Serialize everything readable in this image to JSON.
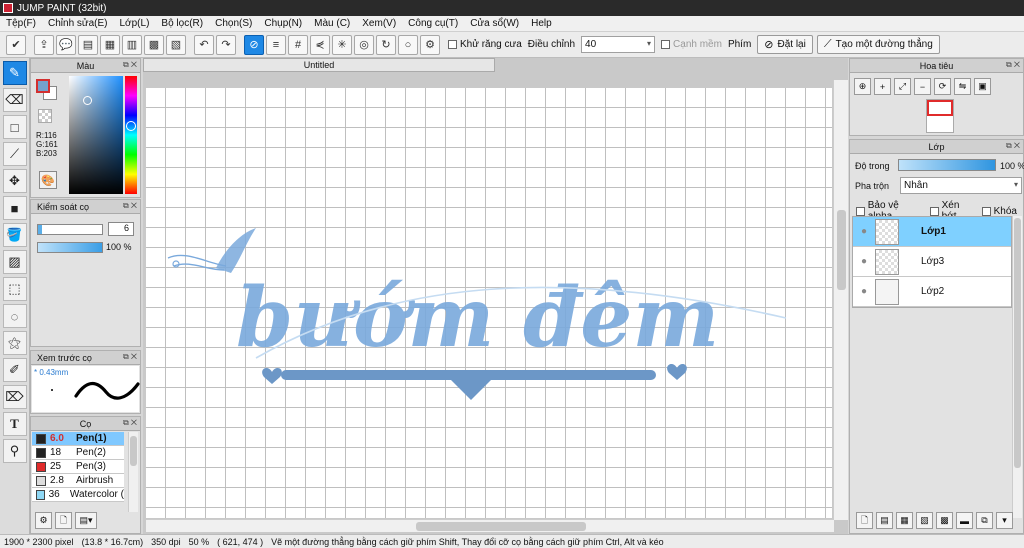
{
  "app": {
    "title": "JUMP PAINT (32bit)"
  },
  "menu": [
    "Tệp(F)",
    "Chỉnh sửa(E)",
    "Lớp(L)",
    "Bộ lọc(R)",
    "Chọn(S)",
    "Chụp(N)",
    "Màu (C)",
    "Xem(V)",
    "Công cụ(T)",
    "Cửa sổ(W)",
    "Help"
  ],
  "toolbar": {
    "antialias_label": "Khử răng cưa",
    "adjust_label": "Điều chỉnh",
    "adjust_value": "40",
    "edge_label": "Cạnh mềm",
    "key_label": "Phím",
    "reset_label": "Đặt lại",
    "straight_line_label": "Tạo một đường thẳng"
  },
  "color_panel": {
    "title": "Màu",
    "r": "R:116",
    "g": "G:161",
    "b": "B:203",
    "current_color": "#74a1cb"
  },
  "brush_control": {
    "title": "Kiểm soát cọ",
    "size": "6",
    "opacity": "100 %"
  },
  "brush_preview": {
    "title": "Xem trước cọ",
    "size_label": "* 0.43mm"
  },
  "brushes": {
    "title": "Cọ",
    "items": [
      {
        "size": "6.0",
        "name": "Pen(1)",
        "color": "#222222",
        "selected": true
      },
      {
        "size": "18",
        "name": "Pen(2)",
        "color": "#222222",
        "selected": false
      },
      {
        "size": "25",
        "name": "Pen(3)",
        "color": "#e02b2b",
        "selected": false
      },
      {
        "size": "2.8",
        "name": "Airbrush",
        "color": "#dddddd",
        "selected": false
      },
      {
        "size": "36",
        "name": "Watercolor (",
        "color": "#8fd8f5",
        "selected": false
      }
    ]
  },
  "document": {
    "tab": "Untitled"
  },
  "artwork": {
    "text": "bướm đêm",
    "color": "#7aa9dc"
  },
  "navigator": {
    "title": "Hoa tiêu"
  },
  "layers": {
    "title": "Lớp",
    "opacity_label": "Độ trong",
    "opacity_value": "100 %",
    "blend_label": "Pha trộn",
    "blend_value": "Nhân",
    "protect_alpha": "Bảo vệ alpha",
    "clip": "Xén bớt",
    "lock": "Khóa",
    "items": [
      {
        "name": "Lớp1",
        "selected": true
      },
      {
        "name": "Lớp3",
        "selected": false
      },
      {
        "name": "Lớp2",
        "selected": false
      }
    ]
  },
  "status": {
    "size": "1900 * 2300 pixel",
    "cm": "(13.8 * 16.7cm)",
    "dpi": "350 dpi",
    "zoom": "50 %",
    "coords": "( 621, 474 )",
    "hint": "Vẽ một đường thẳng bằng cách giữ phím Shift, Thay đổi cỡ cọ bằng cách giữ phím Ctrl, Alt và kéo"
  }
}
